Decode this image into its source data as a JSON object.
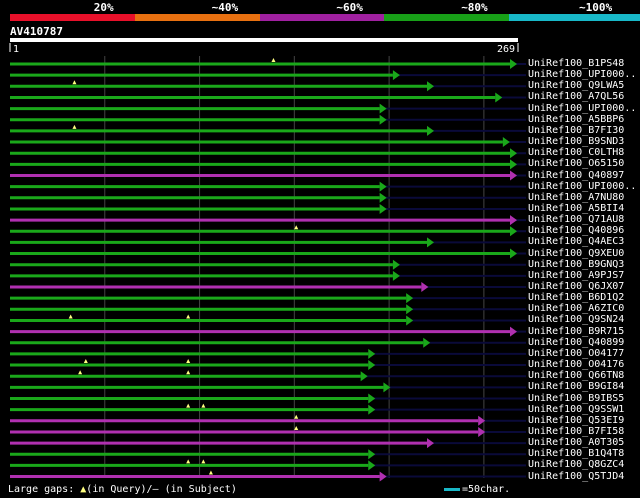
{
  "legend": {
    "labels": [
      "20%",
      "~40%",
      "~60%",
      "~80%",
      "~100%"
    ],
    "colors": [
      "#e8102a",
      "#e87010",
      "#a020a0",
      "#18a018",
      "#18b8c8"
    ]
  },
  "query": {
    "name": "AV410787",
    "start": "1",
    "end": "269",
    "length": 269
  },
  "colors": {
    "green": "#1aa81a",
    "magenta": "#b030b0",
    "dark": "#0a0a3a",
    "grid": "#444444",
    "gap_marker": "#ffff80"
  },
  "hits": [
    {
      "label": "UniRef100_B1PS48",
      "color": "green",
      "start": 1,
      "end": 269,
      "gaps": [
        140
      ]
    },
    {
      "label": "UniRef100_UPI000..",
      "color": "green",
      "start": 1,
      "end": 203,
      "gaps": []
    },
    {
      "label": "UniRef100_Q9LWA5",
      "color": "green",
      "start": 1,
      "end": 221,
      "gaps": [
        35
      ]
    },
    {
      "label": "UniRef100_A7QL56",
      "color": "green",
      "start": 1,
      "end": 257,
      "gaps": []
    },
    {
      "label": "UniRef100_UPI000..",
      "color": "green",
      "start": 1,
      "end": 196,
      "gaps": []
    },
    {
      "label": "UniRef100_A5BBP6",
      "color": "green",
      "start": 1,
      "end": 196,
      "gaps": []
    },
    {
      "label": "UniRef100_B7FI30",
      "color": "green",
      "start": 1,
      "end": 221,
      "gaps": [
        35
      ]
    },
    {
      "label": "UniRef100_B9SND3",
      "color": "green",
      "start": 1,
      "end": 261,
      "gaps": []
    },
    {
      "label": "UniRef100_C0LTH8",
      "color": "green",
      "start": 1,
      "end": 272,
      "gaps": []
    },
    {
      "label": "UniRef100_O65150",
      "color": "green",
      "start": 1,
      "end": 265,
      "gaps": []
    },
    {
      "label": "UniRef100_Q40897",
      "color": "magenta",
      "start": 1,
      "end": 272,
      "gaps": []
    },
    {
      "label": "UniRef100_UPI000..",
      "color": "green",
      "start": 1,
      "end": 196,
      "gaps": []
    },
    {
      "label": "UniRef100_A7NU80",
      "color": "green",
      "start": 1,
      "end": 196,
      "gaps": []
    },
    {
      "label": "UniRef100_A5BII4",
      "color": "green",
      "start": 1,
      "end": 196,
      "gaps": []
    },
    {
      "label": "UniRef100_Q71AU8",
      "color": "magenta",
      "start": 1,
      "end": 269,
      "gaps": []
    },
    {
      "label": "UniRef100_Q40896",
      "color": "green",
      "start": 1,
      "end": 265,
      "gaps": [
        152
      ]
    },
    {
      "label": "UniRef100_Q4AEC3",
      "color": "green",
      "start": 1,
      "end": 221,
      "gaps": []
    },
    {
      "label": "UniRef100_Q9XEU0",
      "color": "green",
      "start": 1,
      "end": 269,
      "gaps": []
    },
    {
      "label": "UniRef100_B9GNQ3",
      "color": "green",
      "start": 1,
      "end": 203,
      "gaps": []
    },
    {
      "label": "UniRef100_A9PJS7",
      "color": "green",
      "start": 1,
      "end": 203,
      "gaps": []
    },
    {
      "label": "UniRef100_Q6JX07",
      "color": "magenta",
      "start": 1,
      "end": 218,
      "gaps": []
    },
    {
      "label": "UniRef100_B6D1Q2",
      "color": "green",
      "start": 1,
      "end": 210,
      "gaps": []
    },
    {
      "label": "UniRef100_A6ZIC0",
      "color": "green",
      "start": 1,
      "end": 210,
      "gaps": []
    },
    {
      "label": "UniRef100_Q9SN24",
      "color": "green",
      "start": 1,
      "end": 210,
      "gaps": [
        33,
        95
      ]
    },
    {
      "label": "UniRef100_B9R715",
      "color": "magenta",
      "start": 1,
      "end": 269,
      "gaps": []
    },
    {
      "label": "UniRef100_Q40899",
      "color": "green",
      "start": 1,
      "end": 219,
      "gaps": []
    },
    {
      "label": "UniRef100_O04177",
      "color": "green",
      "start": 1,
      "end": 190,
      "gaps": []
    },
    {
      "label": "UniRef100_O04176",
      "color": "green",
      "start": 1,
      "end": 190,
      "gaps": [
        41,
        95
      ]
    },
    {
      "label": "UniRef100_Q66TN8",
      "color": "green",
      "start": 1,
      "end": 186,
      "gaps": [
        38,
        95
      ]
    },
    {
      "label": "UniRef100_B9GI84",
      "color": "green",
      "start": 1,
      "end": 198,
      "gaps": []
    },
    {
      "label": "UniRef100_B9IBS5",
      "color": "green",
      "start": 1,
      "end": 190,
      "gaps": []
    },
    {
      "label": "UniRef100_Q9SSW1",
      "color": "green",
      "start": 1,
      "end": 190,
      "gaps": [
        95,
        103
      ]
    },
    {
      "label": "UniRef100_Q53EI9",
      "color": "magenta",
      "start": 1,
      "end": 248,
      "gaps": [
        152
      ]
    },
    {
      "label": "UniRef100_B7FI58",
      "color": "magenta",
      "start": 1,
      "end": 248,
      "gaps": [
        152
      ]
    },
    {
      "label": "UniRef100_A0T305",
      "color": "magenta",
      "start": 1,
      "end": 221,
      "gaps": []
    },
    {
      "label": "UniRef100_B1Q4T8",
      "color": "green",
      "start": 1,
      "end": 190,
      "gaps": []
    },
    {
      "label": "UniRef100_Q8GZC4",
      "color": "green",
      "start": 1,
      "end": 190,
      "gaps": [
        95,
        103
      ]
    },
    {
      "label": "UniRef100_Q5TJD4",
      "color": "magenta",
      "start": 1,
      "end": 196,
      "gaps": [
        107
      ]
    }
  ],
  "footer": {
    "gaps_label": "Large gaps:",
    "in_query": "(in Query)/",
    "in_subject": "(in Subject)",
    "scale_label": "=50char."
  }
}
